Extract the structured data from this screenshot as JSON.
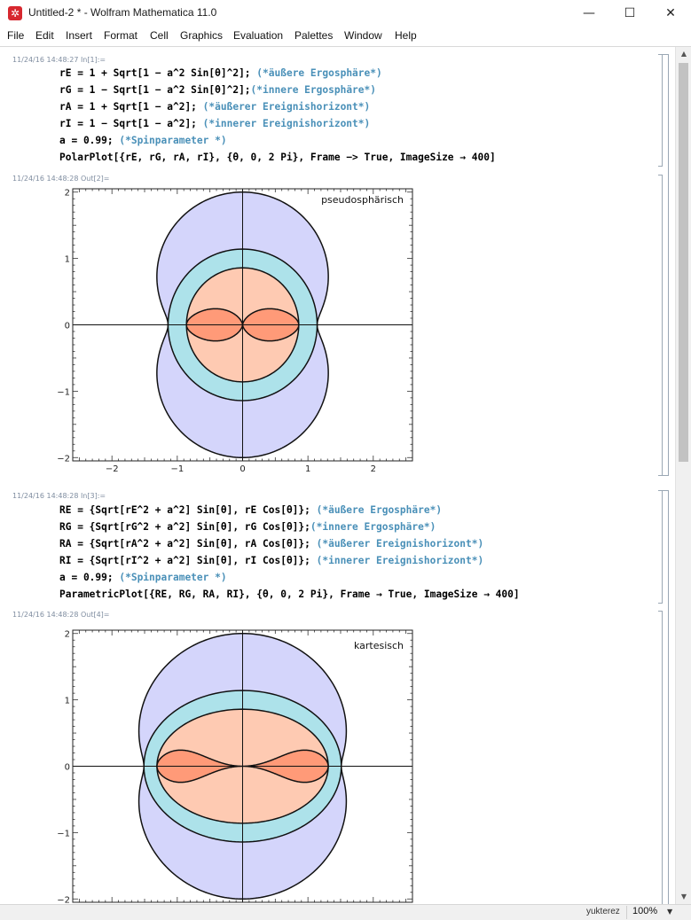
{
  "window": {
    "title": "Untitled-2 * - Wolfram Mathematica 11.0",
    "minimize": "—",
    "maximize": "☐",
    "close": "✕"
  },
  "menu": [
    "File",
    "Edit",
    "Insert",
    "Format",
    "Cell",
    "Graphics",
    "Evaluation",
    "Palettes",
    "Window",
    "Help"
  ],
  "cells": [
    {
      "label": "11/24/16 14:48:27 In[1]:=",
      "lines": [
        {
          "code": "rE = 1 + Sqrt[1 − a^2 Sin[θ]^2]; ",
          "comment": "(*äußere Ergosphäre*)"
        },
        {
          "code": "rG = 1 − Sqrt[1 − a^2 Sin[θ]^2];",
          "comment": "(*innere Ergosphäre*)"
        },
        {
          "code": "rA = 1 + Sqrt[1 − a^2]; ",
          "comment": "(*äußerer Ereignishorizont*)"
        },
        {
          "code": "rI = 1 − Sqrt[1 − a^2]; ",
          "comment": "(*innerer Ereignishorizont*)"
        },
        {
          "code": "a = 0.99; ",
          "comment": "(*Spinparameter *)"
        },
        {
          "code": "PolarPlot[{rE, rG, rA, rI}, {θ, 0, 2 Pi}, Frame −> True, ImageSize → 400]",
          "comment": ""
        }
      ]
    },
    {
      "label": "11/24/16 14:48:28 Out[2]=",
      "plot_label": "pseudosphärisch"
    },
    {
      "label": "11/24/16 14:48:28 In[3]:=",
      "lines": [
        {
          "code": "RE = {Sqrt[rE^2 + a^2] Sin[θ], rE Cos[θ]}; ",
          "comment": "(*äußere Ergosphäre*)"
        },
        {
          "code": "RG = {Sqrt[rG^2 + a^2] Sin[θ], rG Cos[θ]};",
          "comment": "(*innere Ergosphäre*)"
        },
        {
          "code": "RA = {Sqrt[rA^2 + a^2] Sin[θ], rA Cos[θ]}; ",
          "comment": "(*äußerer Ereignishorizont*)"
        },
        {
          "code": "RI = {Sqrt[rI^2 + a^2] Sin[θ], rI Cos[θ]}; ",
          "comment": "(*innerer Ereignishorizont*)"
        },
        {
          "code": "a = 0.99; ",
          "comment": "(*Spinparameter *)"
        },
        {
          "code": "ParametricPlot[{RE, RG, RA, RI}, {θ, 0, 2 Pi}, Frame → True, ImageSize → 400]",
          "comment": ""
        }
      ]
    },
    {
      "label": "11/24/16 14:48:28 Out[4]=",
      "plot_label": "kartesisch"
    }
  ],
  "plot1_ticks": {
    "x": [
      {
        "v": -2,
        "t": "−2"
      },
      {
        "v": -1,
        "t": "−1"
      },
      {
        "v": 0,
        "t": "0"
      },
      {
        "v": 1,
        "t": "1"
      },
      {
        "v": 2,
        "t": "2"
      }
    ],
    "y": [
      {
        "v": 2,
        "t": "2"
      },
      {
        "v": 1,
        "t": "1"
      },
      {
        "v": 0,
        "t": "0"
      },
      {
        "v": -1,
        "t": "−1"
      },
      {
        "v": -2,
        "t": "−2"
      }
    ]
  },
  "plot2_ticks": {
    "y": [
      {
        "v": 2,
        "t": "2"
      },
      {
        "v": 1,
        "t": "1"
      },
      {
        "v": 0,
        "t": "0"
      },
      {
        "v": -1,
        "t": "−1"
      },
      {
        "v": -2,
        "t": "−2"
      }
    ]
  },
  "colors": {
    "outer_ergo": "#d4d5fb",
    "inner_ergo": "#ade2ea",
    "outer_horizon": "#fecab2",
    "inner_horizon": "#ff9a78",
    "comment": "#4a90b8"
  },
  "chart_data": [
    {
      "type": "polar",
      "a": 0.99,
      "series": [
        {
          "name": "rE",
          "r": "1 + Sqrt[1 - a^2 Sin[θ]^2]"
        },
        {
          "name": "rG",
          "r": "1 - Sqrt[1 - a^2 Sin[θ]^2]"
        },
        {
          "name": "rA",
          "r": "1 + Sqrt[1 - a^2]"
        },
        {
          "name": "rI",
          "r": "1 - Sqrt[1 - a^2]"
        }
      ],
      "xlim": [
        -2.6,
        2.6
      ],
      "ylim": [
        -2.05,
        2.05
      ],
      "frame": true
    },
    {
      "type": "parametric",
      "a": 0.99,
      "series": [
        {
          "name": "RE"
        },
        {
          "name": "RG"
        },
        {
          "name": "RA"
        },
        {
          "name": "RI"
        }
      ],
      "xlim": [
        -2.6,
        2.6
      ],
      "ylim": [
        -2.05,
        2.05
      ],
      "frame": true
    }
  ],
  "status": {
    "user": "yukterez",
    "zoom": "100%"
  }
}
